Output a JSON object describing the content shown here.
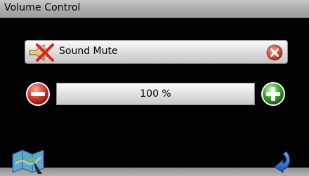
{
  "window": {
    "title": "Volume Control"
  },
  "mute": {
    "label": "Sound Mute",
    "icon": "speaker-muted-icon",
    "close_icon": "close-icon"
  },
  "volume": {
    "value_text": "100 %",
    "level_percent": 100,
    "decrease_icon": "minus-icon",
    "increase_icon": "plus-icon"
  },
  "footer": {
    "left_icon": "map-icon",
    "right_icon": "back-arrow-icon"
  },
  "colors": {
    "background": "#000000",
    "minus_button": "#d63a2a",
    "plus_button": "#3aa02f",
    "close_button": "#d64a3c",
    "back_arrow": "#2a64c8"
  }
}
